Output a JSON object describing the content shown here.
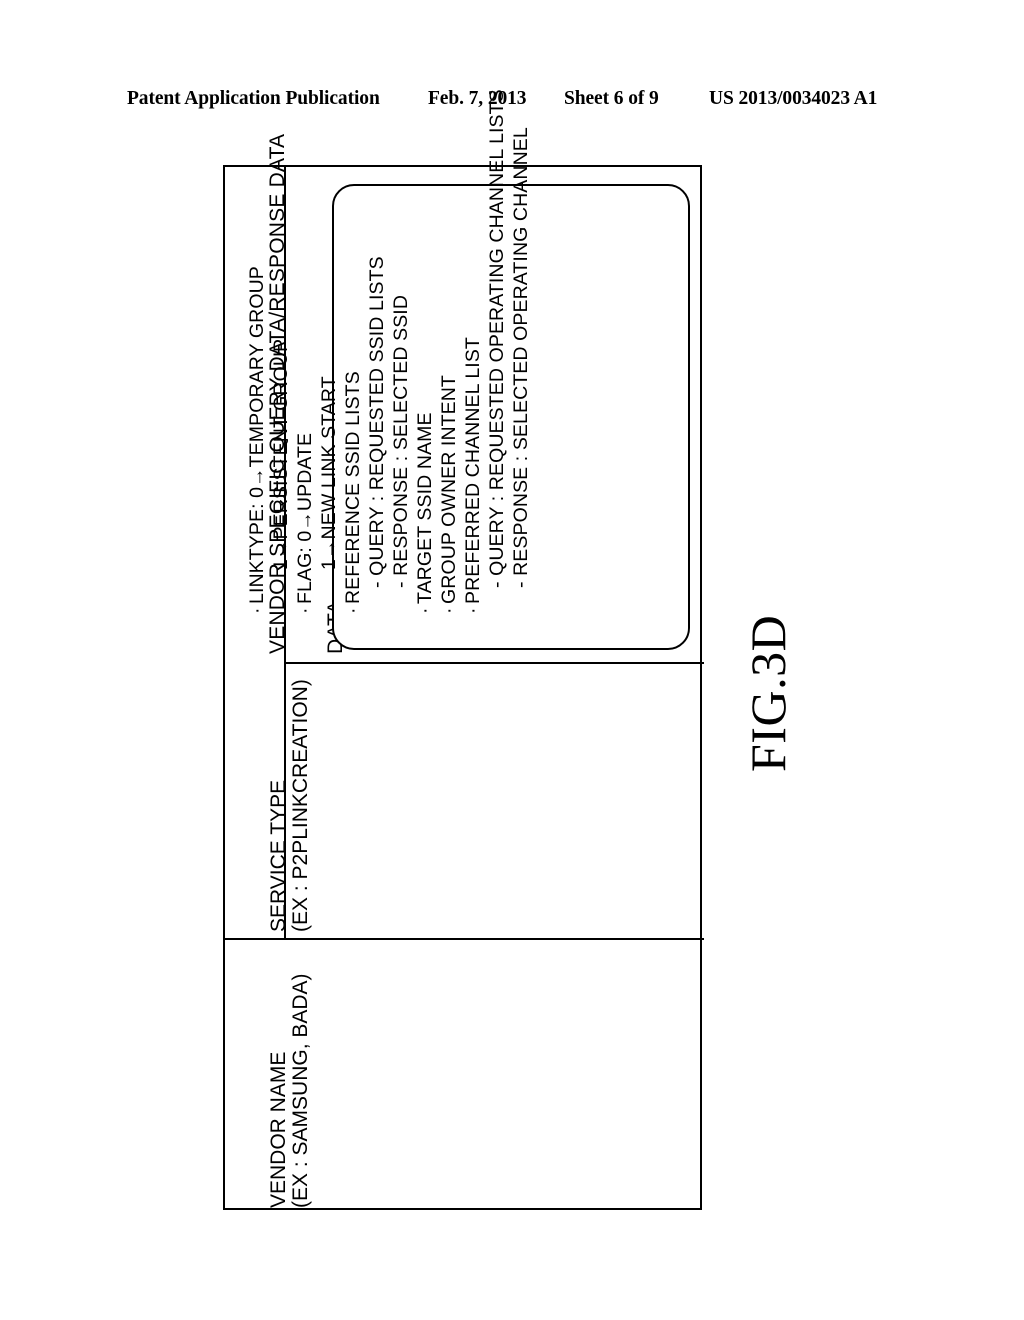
{
  "header": {
    "publication": "Patent Application Publication",
    "date": "Feb. 7, 2013",
    "sheet": "Sheet 6 of 9",
    "number": "US 2013/0034023 A1"
  },
  "figure": {
    "caption": "FIG.3D",
    "block_title": "VENDOR SPECIFIC QUERY DATA/RESPONSE DATA",
    "rows": {
      "data": {
        "label": "DATA",
        "bullets": [
          {
            "marker": "·",
            "indent": 0,
            "text": "LINKTYPE: 0→TEMPORARY GROUP"
          },
          {
            "marker": "",
            "indent": 1,
            "text": "1→PERSISTENT GROUP"
          },
          {
            "marker": "·",
            "indent": 0,
            "text": "FLAG: 0→UPDATE"
          },
          {
            "marker": "",
            "indent": 1,
            "text": "1→NEW LINK START"
          },
          {
            "marker": "·",
            "indent": 0,
            "text": "REFERENCE SSID LISTS"
          },
          {
            "marker": "",
            "indent": 2,
            "text": "- QUERY : REQUESTED SSID LISTS"
          },
          {
            "marker": "",
            "indent": 2,
            "text": "- RESPONSE : SELECTED SSID"
          },
          {
            "marker": "·",
            "indent": 0,
            "text": "TARGET SSID NAME"
          },
          {
            "marker": "·",
            "indent": 0,
            "text": "GROUP OWNER INTENT"
          },
          {
            "marker": "·",
            "indent": 0,
            "text": "PREFERRED CHANNEL LIST"
          },
          {
            "marker": "",
            "indent": 2,
            "text": "- QUERY : REQUESTED OPERATING CHANNEL LISTS"
          },
          {
            "marker": "",
            "indent": 2,
            "text": "- RESPONSE : SELECTED OPERATING CHANNEL"
          }
        ]
      },
      "service_type": {
        "line1": "SERVICE TYPE",
        "line2": "(EX : P2PLINKCREATION)"
      },
      "vendor_name": {
        "line1": "VENDOR NAME",
        "line2": "(EX : SAMSUNG, BADA)"
      }
    }
  },
  "colors": {
    "ink": "#000000",
    "paper": "#ffffff"
  }
}
